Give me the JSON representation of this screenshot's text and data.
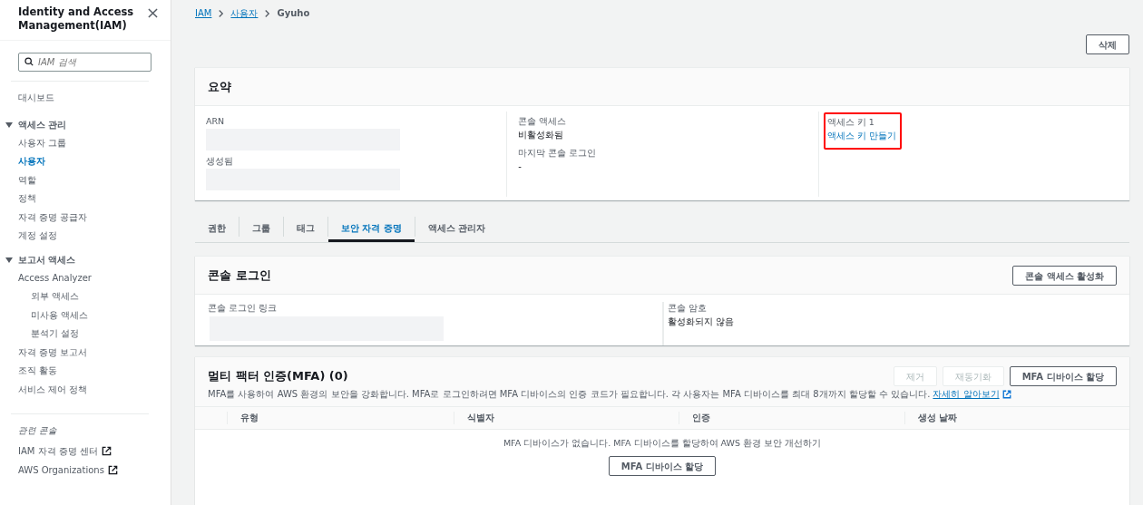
{
  "sidebar": {
    "title": "Identity and Access Management(IAM)",
    "search": {
      "placeholder": "IAM 검색"
    },
    "items": [
      {
        "kind": "link",
        "label": "대시보드",
        "selected": false
      },
      {
        "kind": "section",
        "label": "액세스 관리",
        "expanded": true,
        "children": [
          {
            "label": "사용자 그룹",
            "selected": false
          },
          {
            "label": "사용자",
            "selected": true
          },
          {
            "label": "역할",
            "selected": false
          },
          {
            "label": "정책",
            "selected": false
          },
          {
            "label": "자격 증명 공급자",
            "selected": false
          },
          {
            "label": "계정 설정",
            "selected": false
          }
        ]
      },
      {
        "kind": "section",
        "label": "보고서 액세스",
        "expanded": true,
        "children": [
          {
            "label": "Access Analyzer",
            "selected": false,
            "children": [
              {
                "label": "외부 액세스",
                "selected": false
              },
              {
                "label": "미사용 액세스",
                "selected": false
              },
              {
                "label": "분석기 설정",
                "selected": false
              }
            ]
          },
          {
            "label": "자격 증명 보고서",
            "selected": false
          },
          {
            "label": "조직 활동",
            "selected": false
          },
          {
            "label": "서비스 제어 정책",
            "selected": false
          }
        ]
      }
    ],
    "related": {
      "title": "관련 콘솔",
      "links": [
        {
          "label": "IAM 자격 증명 센터",
          "external": true
        },
        {
          "label": "AWS Organizations",
          "external": true
        }
      ]
    }
  },
  "breadcrumb": [
    {
      "label": "IAM",
      "link": true
    },
    {
      "label": "사용자",
      "link": true
    },
    {
      "label": "Gyuho",
      "link": false
    }
  ],
  "delete_button": "삭제",
  "summary": {
    "title": "요약",
    "columns": [
      {
        "highlighted": false,
        "fields": [
          {
            "label": "ARN",
            "redacted": true
          },
          {
            "label": "생성됨",
            "redacted": true
          }
        ]
      },
      {
        "highlighted": false,
        "fields": [
          {
            "label": "콘솔 액세스",
            "value": "비활성화됨"
          },
          {
            "label": "마지막 콘솔 로그인",
            "value": "-"
          }
        ]
      },
      {
        "highlighted": true,
        "fields": [
          {
            "label": "액세스 키 1",
            "link": "액세스 키 만들기"
          }
        ]
      }
    ]
  },
  "tabs": [
    {
      "label": "권한",
      "selected": false
    },
    {
      "label": "그룹",
      "selected": false
    },
    {
      "label": "태그",
      "selected": false
    },
    {
      "label": "보안 자격 증명",
      "selected": true
    },
    {
      "label": "액세스 관리자",
      "selected": false
    }
  ],
  "console_login": {
    "title": "콘솔 로그인",
    "button": "콘솔 액세스 활성화",
    "fields": [
      {
        "label": "콘솔 로그인 링크",
        "redacted": true
      },
      {
        "label": "콘솔 암호",
        "value": "활성화되지 않음"
      }
    ]
  },
  "mfa": {
    "title": "멀티 팩터 인증(MFA) (0)",
    "description": "MFA를 사용하여 AWS 환경의 보안을 강화합니다. MFA로 로그인하려면 MFA 디바이스의 인증 코드가 필요합니다. 각 사용자는 MFA 디바이스를 최대 8개까지 할당할 수 있습니다.",
    "learn_more": "자세히 알아보기",
    "buttons": [
      {
        "label": "제거",
        "disabled": true
      },
      {
        "label": "재동기화",
        "disabled": true
      },
      {
        "label": "MFA 디바이스 할당",
        "disabled": false
      }
    ],
    "columns": [
      "유형",
      "식별자",
      "인증",
      "생성 날짜"
    ],
    "empty_message": "MFA 디바이스가 없습니다. MFA 디바이스를 할당하여 AWS 환경 보안 개선하기",
    "empty_button": "MFA 디바이스 할당"
  }
}
